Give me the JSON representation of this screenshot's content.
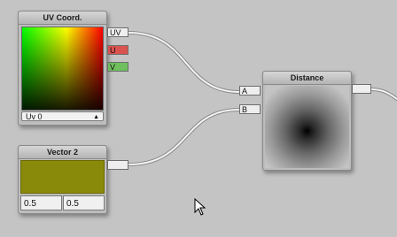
{
  "uv_node": {
    "title": "UV Coord.",
    "outputs": [
      "UV",
      "U",
      "V"
    ],
    "dropdown_value": "Uv 0"
  },
  "vector2_node": {
    "title": "Vector 2",
    "swatch_color": "#8a8a0a",
    "x_value": "0.5",
    "y_value": "0.5"
  },
  "distance_node": {
    "title": "Distance",
    "inputs": [
      "A",
      "B"
    ]
  },
  "colors": {
    "background": "#c4c4c4",
    "port_u": "#d9534f",
    "port_v": "#6fbf5f",
    "wire": "#f0f0f0"
  }
}
